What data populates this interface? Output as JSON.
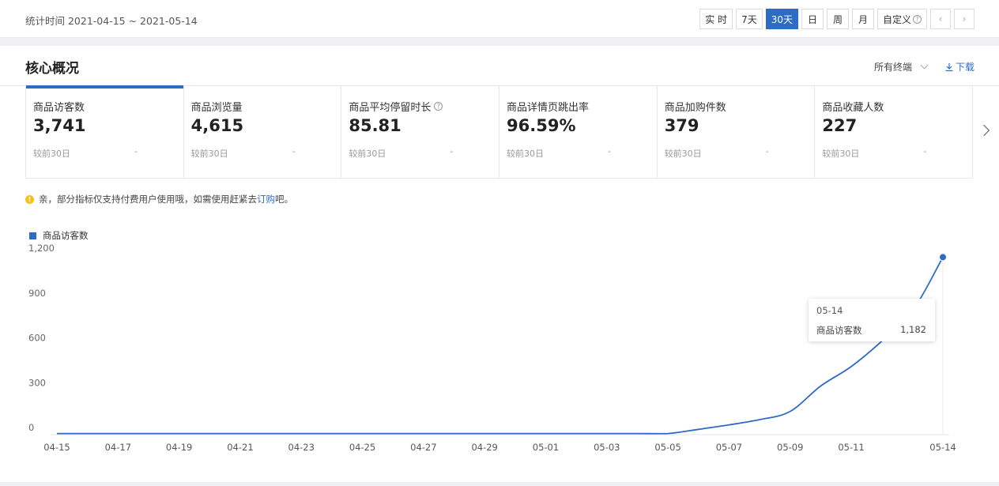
{
  "toolbar": {
    "date_range": "统计时间 2021-04-15 ~ 2021-05-14",
    "ranges": [
      "实 时",
      "7天",
      "30天",
      "日",
      "周",
      "月",
      "自定义"
    ],
    "active_range": "30天",
    "help_icon": "question-circle-icon",
    "prev_icon": "chevron-left-icon",
    "next_icon": "chevron-right-icon"
  },
  "card": {
    "title": "核心概况",
    "terminal": "所有终端",
    "download": "下载"
  },
  "metrics": [
    {
      "label": "商品访客数",
      "value": "3,741",
      "compare": "较前30日",
      "delta": "-",
      "help": false
    },
    {
      "label": "商品浏览量",
      "value": "4,615",
      "compare": "较前30日",
      "delta": "-",
      "help": false
    },
    {
      "label": "商品平均停留时长",
      "value": "85.81",
      "compare": "较前30日",
      "delta": "-",
      "help": true
    },
    {
      "label": "商品详情页跳出率",
      "value": "96.59%",
      "compare": "较前30日",
      "delta": "-",
      "help": false
    },
    {
      "label": "商品加购件数",
      "value": "379",
      "compare": "较前30日",
      "delta": "-",
      "help": false
    },
    {
      "label": "商品收藏人数",
      "value": "227",
      "compare": "较前30日",
      "delta": "-",
      "help": false
    }
  ],
  "notice": {
    "text": "亲，部分指标仅支持付费用户使用哦，如需使用赶紧去",
    "link": "订购",
    "suffix": "吧。"
  },
  "tooltip": {
    "date": "05-14",
    "series": "商品访客数",
    "value": "1,182"
  },
  "chart_data": {
    "type": "line",
    "series": [
      {
        "name": "商品访客数",
        "values": [
          2,
          2,
          2,
          2,
          2,
          2,
          2,
          2,
          2,
          2,
          2,
          2,
          2,
          2,
          2,
          2,
          2,
          2,
          2,
          2,
          2,
          30,
          60,
          95,
          150,
          320,
          450,
          620,
          820,
          1182
        ]
      }
    ],
    "x": [
      "04-15",
      "04-16",
      "04-17",
      "04-18",
      "04-19",
      "04-20",
      "04-21",
      "04-22",
      "04-23",
      "04-24",
      "04-25",
      "04-26",
      "04-27",
      "04-28",
      "04-29",
      "04-30",
      "05-01",
      "05-02",
      "05-03",
      "05-04",
      "05-05",
      "05-06",
      "05-07",
      "05-08",
      "05-09",
      "05-10",
      "05-11",
      "05-12",
      "05-13",
      "05-14"
    ],
    "x_ticks": [
      "04-15",
      "04-17",
      "04-19",
      "04-21",
      "04-23",
      "04-25",
      "04-27",
      "04-29",
      "05-01",
      "05-03",
      "05-05",
      "05-07",
      "05-09",
      "05-11",
      "05-14"
    ],
    "y_ticks": [
      "0",
      "300",
      "600",
      "900",
      "1,200"
    ],
    "ylim": [
      0,
      1200
    ],
    "legend": "top-left",
    "grid": false,
    "color": "#2d6bc4"
  }
}
